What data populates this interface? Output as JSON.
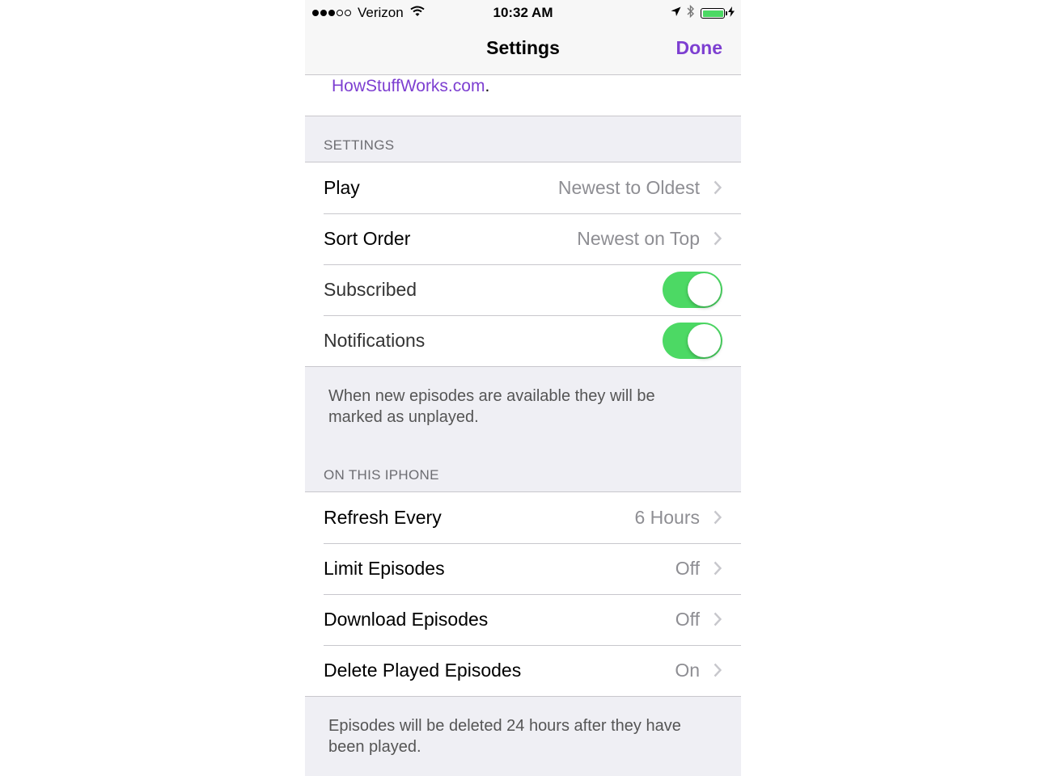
{
  "status_bar": {
    "carrier": "Verizon",
    "time": "10:32 AM",
    "battery_color": "#4cd964"
  },
  "nav": {
    "title": "Settings",
    "done_label": "Done"
  },
  "link_row": {
    "link": "HowStuffWorks.com",
    "suffix": "."
  },
  "sections": {
    "settings": {
      "header": "SETTINGS",
      "rows": [
        {
          "label": "Play",
          "value": "Newest to Oldest"
        },
        {
          "label": "Sort Order",
          "value": "Newest on Top"
        },
        {
          "label": "Subscribed",
          "toggle": true
        },
        {
          "label": "Notifications",
          "toggle": true
        }
      ],
      "footer": "When new episodes are available they will be marked as unplayed."
    },
    "on_this_iphone": {
      "header": "ON THIS IPHONE",
      "rows": [
        {
          "label": "Refresh Every",
          "value": "6 Hours"
        },
        {
          "label": "Limit Episodes",
          "value": "Off"
        },
        {
          "label": "Download Episodes",
          "value": "Off"
        },
        {
          "label": "Delete Played Episodes",
          "value": "On"
        }
      ],
      "footer": "Episodes will be deleted 24 hours after they have been played."
    }
  },
  "colors": {
    "accent": "#7d3fd1",
    "toggle_on": "#4cd964",
    "secondary_text": "#8e8e93",
    "group_background": "#efeff4"
  }
}
